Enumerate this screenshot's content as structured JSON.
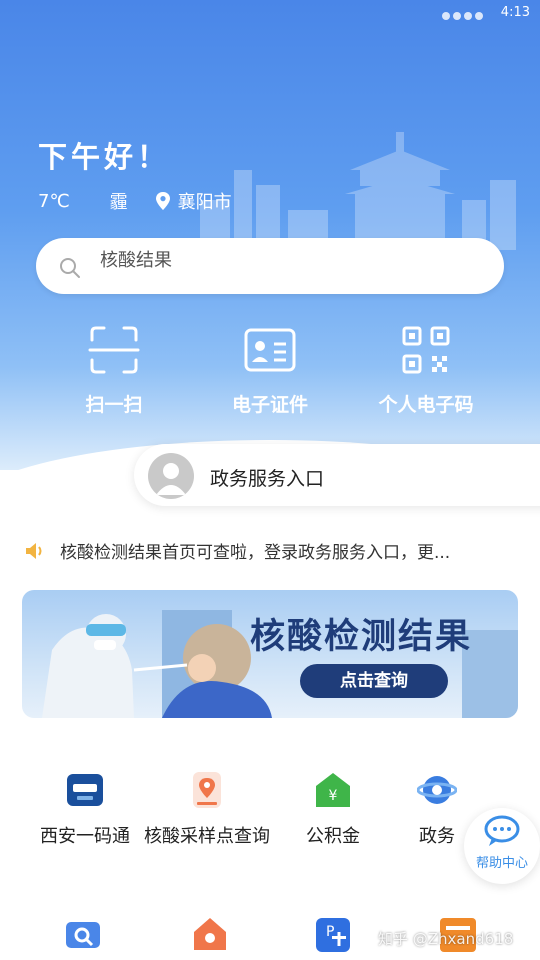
{
  "status_bar": {
    "time": "4:13"
  },
  "header": {
    "greeting": "下午好！",
    "temperature": "7℃",
    "weather": "霾",
    "location": "襄阳市"
  },
  "search": {
    "placeholder": "核酸结果"
  },
  "quick_actions": [
    {
      "label": "扫一扫",
      "icon": "scan-icon"
    },
    {
      "label": "电子证件",
      "icon": "id-card-icon"
    },
    {
      "label": "个人电子码",
      "icon": "qr-code-icon"
    }
  ],
  "gov_entry": {
    "label": "政务服务入口"
  },
  "notice": {
    "text": "核酸检测结果首页可查啦，登录政务服务入口，更..."
  },
  "banner": {
    "title": "核酸检测结果",
    "button": "点击查询"
  },
  "services": [
    {
      "label": "西安一码通",
      "icon": "xian-code-icon",
      "color": "#1a4f9c"
    },
    {
      "label": "核酸采样点查询",
      "icon": "sampling-point-icon",
      "color": "#f0764a"
    },
    {
      "label": "公积金",
      "icon": "housing-fund-icon",
      "color": "#3fb549"
    },
    {
      "label": "政务",
      "icon": "gov-affairs-icon",
      "color": "#3a7de0"
    }
  ],
  "help": {
    "label": "帮助中心"
  },
  "watermark": "知乎 @Zhxand618",
  "colors": {
    "primary": "#4a86e8",
    "banner_text": "#1f3d7a",
    "help": "#3a8ee6"
  }
}
